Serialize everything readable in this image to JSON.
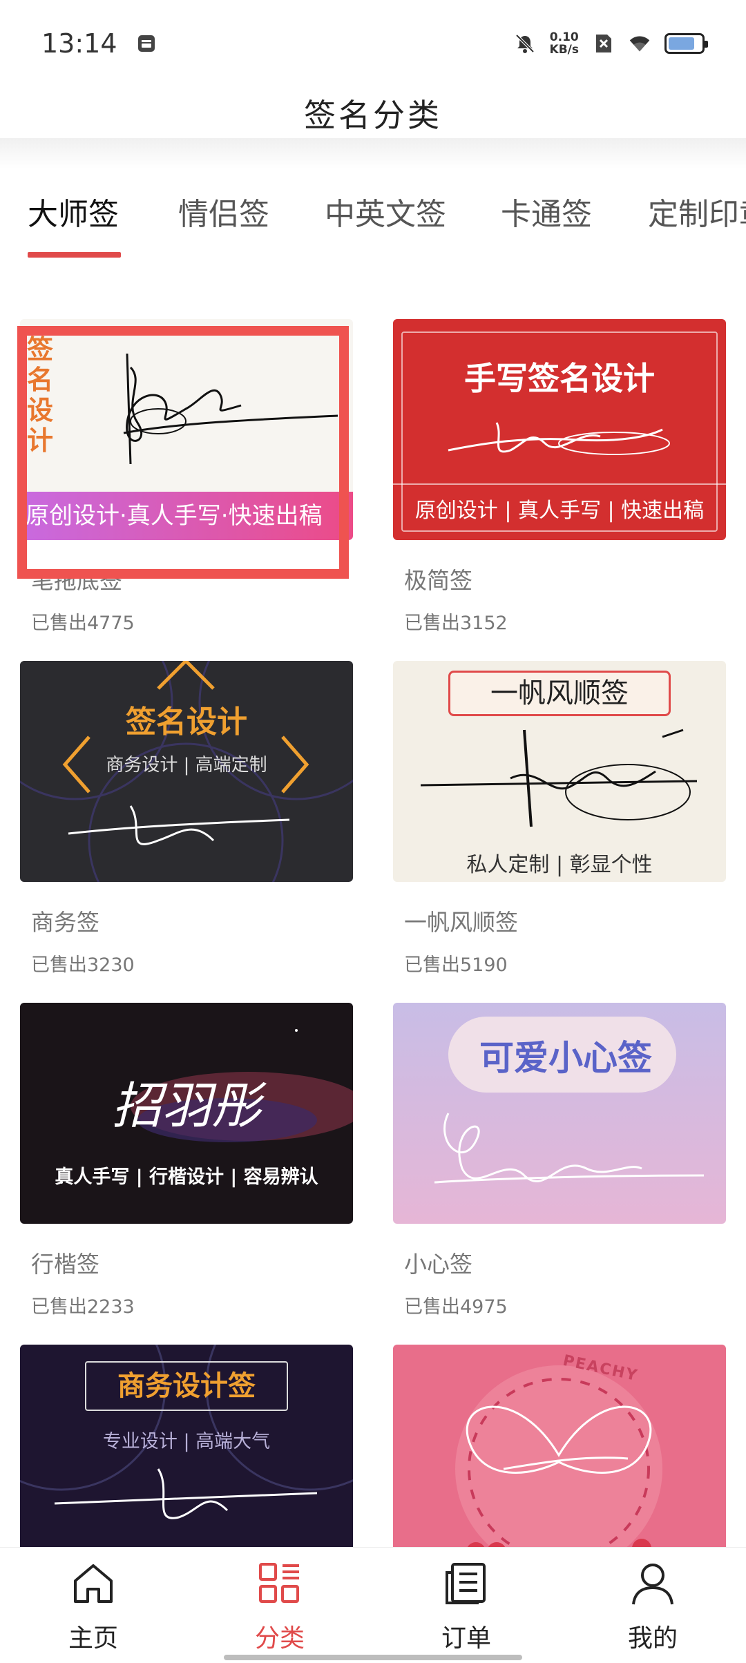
{
  "status_bar": {
    "time": "13:14",
    "net_speed_value": "0.10",
    "net_speed_unit": "KB/s",
    "battery_level": 0.8,
    "icons": [
      "notification-icon",
      "mute-icon",
      "sim-off-icon",
      "wifi-icon",
      "battery-icon"
    ]
  },
  "header": {
    "title": "签名分类"
  },
  "tabs": [
    {
      "label": "大师签",
      "active": true
    },
    {
      "label": "情侣签",
      "active": false
    },
    {
      "label": "中英文签",
      "active": false
    },
    {
      "label": "卡通签",
      "active": false
    },
    {
      "label": "定制印章",
      "active": false
    }
  ],
  "products": [
    {
      "title": "笔拖底签",
      "sold": "已售出4775",
      "thumb": {
        "side_text": [
          "签",
          "名",
          "设",
          "计"
        ],
        "banner": "原创设计·真人手写·快速出稿",
        "colors": {
          "bg": "#f7f5f1",
          "banner": "#e94b8a",
          "side": "#e8772e"
        }
      }
    },
    {
      "title": "极简签",
      "sold": "已售出3152",
      "thumb": {
        "heading": "手写签名设计",
        "footer": "原创设计 | 真人手写 | 快速出稿",
        "colors": {
          "bg": "#d32f2f"
        }
      }
    },
    {
      "title": "商务签",
      "sold": "已售出3230",
      "thumb": {
        "heading": "签名设计",
        "subheading": "商务设计 | 高端定制",
        "colors": {
          "bg": "#2b2b2f",
          "accent": "#f0a030"
        }
      }
    },
    {
      "title": "一帆风顺签",
      "sold": "已售出5190",
      "thumb": {
        "heading": "一帆风顺签",
        "footer": "私人定制 | 彰显个性",
        "colors": {
          "bg": "#f3efe6",
          "accent": "#e04a4a"
        }
      }
    },
    {
      "title": "行楷签",
      "sold": "已售出2233",
      "thumb": {
        "signature": "招羽彤",
        "footer": "真人手写 | 行楷设计 | 容易辨认",
        "colors": {
          "bg": "#1a1418",
          "accent": "#b43a55"
        }
      }
    },
    {
      "title": "小心签",
      "sold": "已售出4975",
      "thumb": {
        "heading": "可爱小心签",
        "colors": {
          "bg": "#d9b8e2",
          "accent": "#5a63c8"
        }
      }
    },
    {
      "title": "",
      "sold": "",
      "thumb": {
        "heading": "商务设计签",
        "subheading": "专业设计 | 高端大气",
        "colors": {
          "bg": "#1e1530",
          "accent": "#f0a030"
        }
      }
    },
    {
      "title": "",
      "sold": "",
      "thumb": {
        "badge": "PEACHY",
        "colors": {
          "bg": "#e86e8a"
        }
      }
    }
  ],
  "bottom_nav": [
    {
      "label": "主页",
      "icon": "home-icon",
      "active": false
    },
    {
      "label": "分类",
      "icon": "category-icon",
      "active": true
    },
    {
      "label": "订单",
      "icon": "order-icon",
      "active": false
    },
    {
      "label": "我的",
      "icon": "user-icon",
      "active": false
    }
  ],
  "colors": {
    "accent": "#e04a4a",
    "selection": "#ef5350"
  }
}
